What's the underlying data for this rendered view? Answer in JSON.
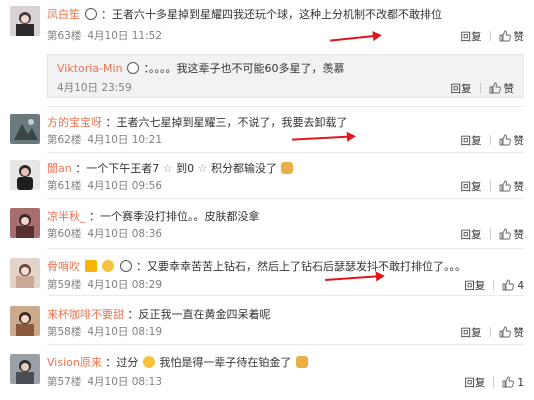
{
  "comments": [
    {
      "user": "凤白笙",
      "text": "：王者六十多星掉到星耀四我还玩个球，这种上分机制不改都不敢排位",
      "floor": "第63楼",
      "time": "4月10日 11:52",
      "reply": "回复",
      "like": "赞",
      "avatar_color": "#c9c2c4",
      "sub": {
        "user": "Viktoria-Min",
        "text": "：。。。。我这辈子也不可能60多星了，羡慕",
        "time": "4月10日 23:59",
        "reply": "回复",
        "like": "赞"
      }
    },
    {
      "user": "方的宝宝呀",
      "text": "：王者六七星掉到星耀三，不说了，我要去卸载了",
      "floor": "第62楼",
      "time": "4月10日 10:21",
      "reply": "回复",
      "like": "赞",
      "avatar_color": "#6b7a7f"
    },
    {
      "user": "闇an",
      "text": "：一个下午王者7",
      "text2": "到0",
      "text3": "积分都输没了",
      "floor": "第61楼",
      "time": "4月10日 09:56",
      "reply": "回复",
      "like": "赞",
      "avatar_color": "#2a2a2a"
    },
    {
      "user": "凉半秋_",
      "text": "：一个赛季没打排位。。皮肤都没拿",
      "floor": "第60楼",
      "time": "4月10日 08:36",
      "reply": "回复",
      "like": "赞",
      "avatar_color": "#7a4a4a"
    },
    {
      "user": "骨哨吹",
      "text": "：又要幸幸苦苦上钻石，然后上了钻石后瑟瑟发抖不敢打排位了。。。",
      "floor": "第59楼",
      "time": "4月10日 08:29",
      "reply": "回复",
      "like": "4",
      "avatar_color": "#d8c8bc"
    },
    {
      "user": "来杯咖啡不要甜",
      "text": "：反正我一直在黄金四呆着呢",
      "floor": "第58楼",
      "time": "4月10日 08:19",
      "reply": "回复",
      "like": "赞",
      "avatar_color": "#b58a6a"
    },
    {
      "user": "Vision原来",
      "text": "：过分",
      "text2": "我怕是得一辈子待在铂金了",
      "floor": "第57楼",
      "time": "4月10日 08:13",
      "reply": "回复",
      "like": "1",
      "avatar_color": "#8a8f96"
    }
  ],
  "colors": {
    "username": "#eb7350",
    "meta": "#808080",
    "arrow": "#e0161c"
  }
}
